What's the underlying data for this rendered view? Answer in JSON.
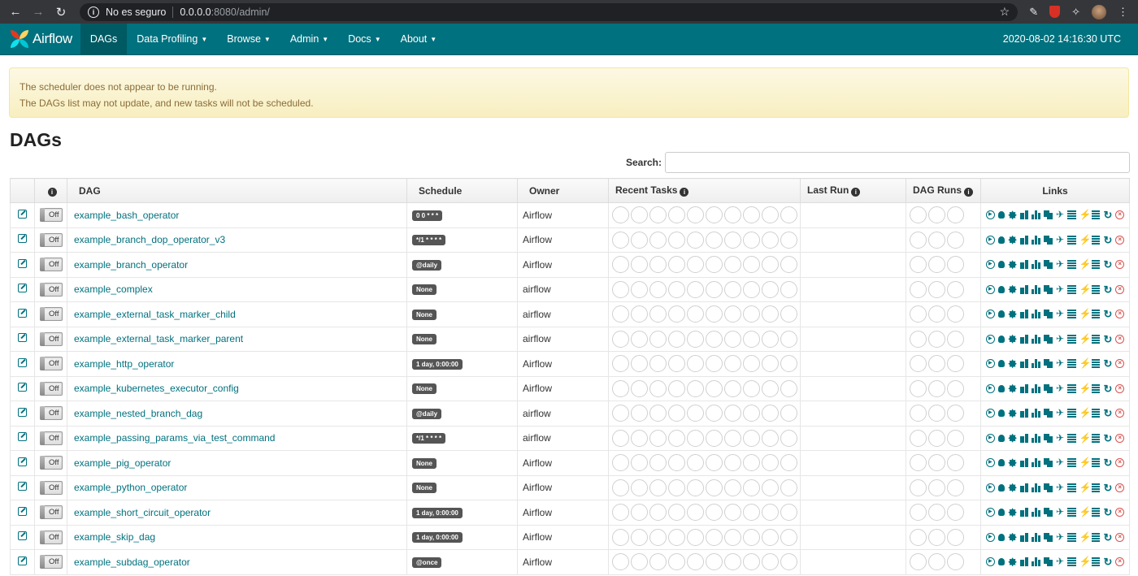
{
  "browser": {
    "security_label": "No es seguro",
    "url_host": "0.0.0.0",
    "url_rest": ":8080/admin/"
  },
  "navbar": {
    "brand": "Airflow",
    "items": [
      {
        "label": "DAGs",
        "active": true,
        "dropdown": false
      },
      {
        "label": "Data Profiling",
        "dropdown": true
      },
      {
        "label": "Browse",
        "dropdown": true
      },
      {
        "label": "Admin",
        "dropdown": true
      },
      {
        "label": "Docs",
        "dropdown": true
      },
      {
        "label": "About",
        "dropdown": true
      }
    ],
    "time": "2020-08-02 14:16:30 UTC",
    "brand_color": "#00717e"
  },
  "alert": {
    "line1": "The scheduler does not appear to be running.",
    "line2": "The DAGs list may not update, and new tasks will not be scheduled."
  },
  "page_title": "DAGs",
  "search": {
    "label": "Search:",
    "placeholder": ""
  },
  "table": {
    "headers": {
      "info_icon": "i",
      "dag": "DAG",
      "schedule": "Schedule",
      "owner": "Owner",
      "recent_tasks": "Recent Tasks",
      "last_run": "Last Run",
      "dag_runs": "DAG Runs",
      "links": "Links"
    },
    "toggle_label": "Off",
    "recent_task_circles": 10,
    "dag_run_circles": 3,
    "rows": [
      {
        "dag": "example_bash_operator",
        "schedule": "0 0 * * *",
        "owner": "Airflow"
      },
      {
        "dag": "example_branch_dop_operator_v3",
        "schedule": "*/1 * * * *",
        "owner": "Airflow"
      },
      {
        "dag": "example_branch_operator",
        "schedule": "@daily",
        "owner": "Airflow"
      },
      {
        "dag": "example_complex",
        "schedule": "None",
        "owner": "airflow"
      },
      {
        "dag": "example_external_task_marker_child",
        "schedule": "None",
        "owner": "airflow"
      },
      {
        "dag": "example_external_task_marker_parent",
        "schedule": "None",
        "owner": "airflow"
      },
      {
        "dag": "example_http_operator",
        "schedule": "1 day, 0:00:00",
        "owner": "Airflow"
      },
      {
        "dag": "example_kubernetes_executor_config",
        "schedule": "None",
        "owner": "Airflow"
      },
      {
        "dag": "example_nested_branch_dag",
        "schedule": "@daily",
        "owner": "airflow"
      },
      {
        "dag": "example_passing_params_via_test_command",
        "schedule": "*/1 * * * *",
        "owner": "airflow"
      },
      {
        "dag": "example_pig_operator",
        "schedule": "None",
        "owner": "Airflow"
      },
      {
        "dag": "example_python_operator",
        "schedule": "None",
        "owner": "Airflow"
      },
      {
        "dag": "example_short_circuit_operator",
        "schedule": "1 day, 0:00:00",
        "owner": "Airflow"
      },
      {
        "dag": "example_skip_dag",
        "schedule": "1 day, 0:00:00",
        "owner": "Airflow"
      },
      {
        "dag": "example_subdag_operator",
        "schedule": "@once",
        "owner": "Airflow"
      }
    ],
    "link_icons": [
      "trigger-dag-icon",
      "tree-view-icon",
      "graph-view-icon",
      "duration-icon",
      "task-tries-icon",
      "landing-times-icon",
      "gantt-icon",
      "code-icon",
      "logs-icon",
      "refresh-icon",
      "delete-icon"
    ]
  }
}
